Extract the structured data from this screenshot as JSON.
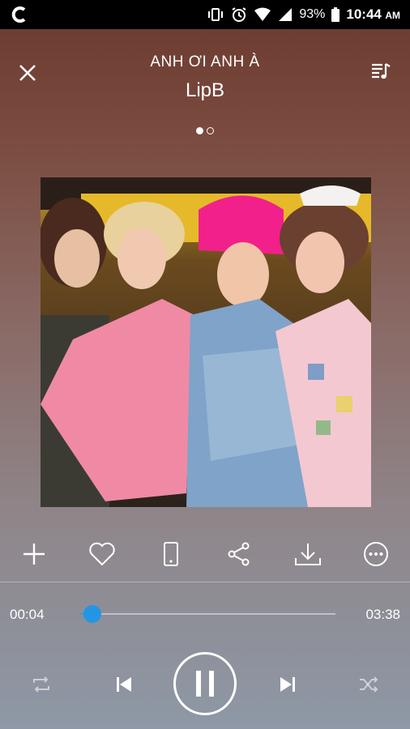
{
  "status_bar": {
    "app_icon": "c-logo-icon",
    "battery_percent": "93%",
    "time": "10:44",
    "ampm": "AM",
    "icons": [
      "vibrate-icon",
      "alarm-icon",
      "wifi-icon",
      "signal-icon",
      "battery-icon"
    ]
  },
  "header": {
    "close_icon": "close-icon",
    "song_title": "ANH ƠI ANH À",
    "artist": "LipB",
    "queue_icon": "playlist-icon"
  },
  "pager": {
    "pages": 2,
    "active": 0
  },
  "actions": [
    "add-icon",
    "heart-icon",
    "phone-icon",
    "share-icon",
    "download-icon",
    "more-icon"
  ],
  "player": {
    "current_time": "00:04",
    "total_time": "03:38",
    "progress": 0.05,
    "accent": "#2296e4"
  },
  "controls": [
    "repeat-icon",
    "previous-icon",
    "pause-icon",
    "next-icon",
    "shuffle-icon"
  ]
}
